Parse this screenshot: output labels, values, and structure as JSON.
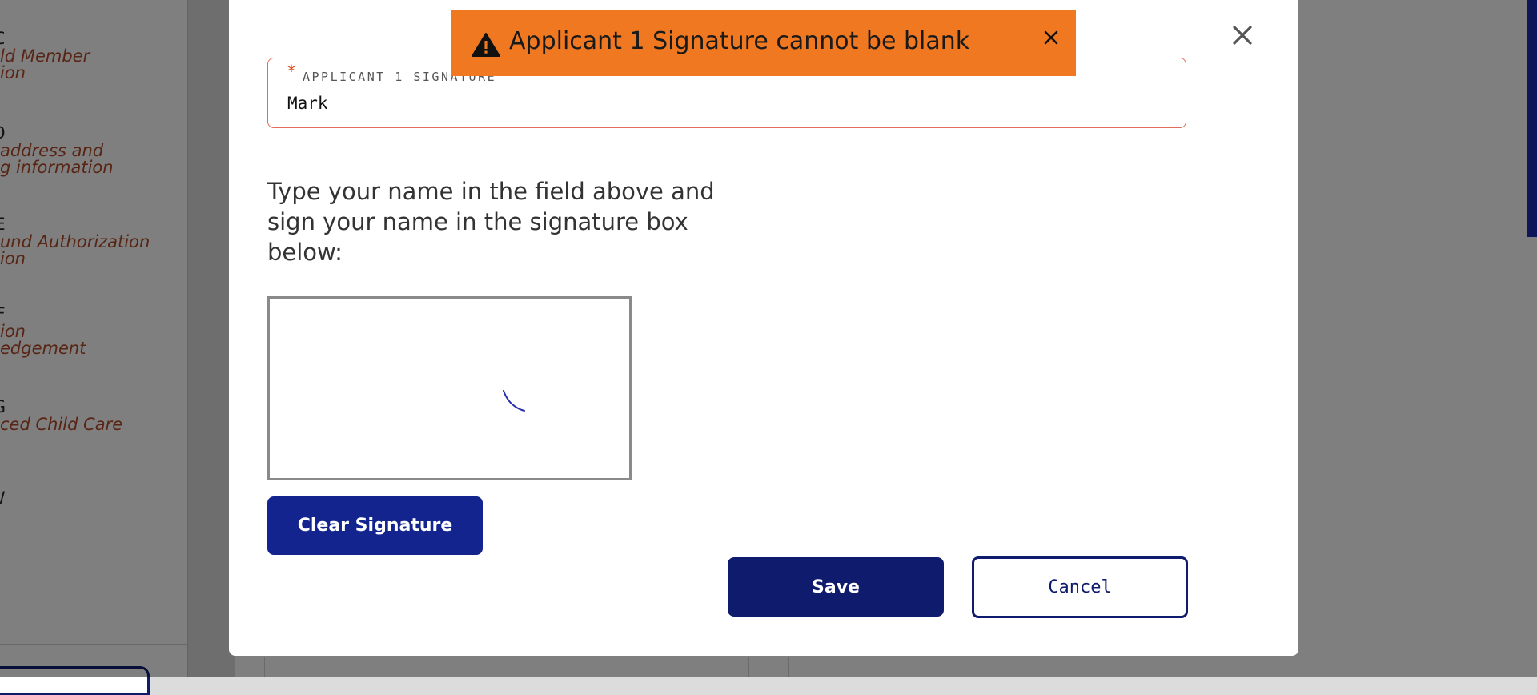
{
  "background": {
    "steps": [
      {
        "letter": "C",
        "desc_lines": [
          "ld Member",
          "ion"
        ]
      },
      {
        "letter": "D",
        "desc_lines": [
          " address and",
          "g information"
        ]
      },
      {
        "letter": "E",
        "desc_lines": [
          "und Authorization",
          "ion"
        ]
      },
      {
        "letter": "F",
        "desc_lines": [
          "ion",
          "edgement"
        ]
      },
      {
        "letter": "G",
        "desc_lines": [
          "ced Child Care"
        ]
      },
      {
        "letter": "V",
        "desc_lines": []
      }
    ]
  },
  "modal": {
    "close_icon": "close-icon",
    "signature_field": {
      "required_marker": "*",
      "label": "APPLICANT 1 SIGNATURE",
      "value": "Mark"
    },
    "instructions": "Type your name in the field above and sign your name in the signature box below:",
    "signature_pad": {
      "stroke_color": "#2a2fb0"
    },
    "clear_button": "Clear Signature",
    "save_button": "Save",
    "cancel_button": "Cancel"
  },
  "toast": {
    "icon": "warning-icon",
    "message": "Applicant 1 Signature cannot be blank",
    "close_icon": "close-icon",
    "color": "#f07821"
  },
  "colors": {
    "primary": "#0f1c6e",
    "clear_button": "#13248f",
    "error_border": "#e26d5f"
  }
}
